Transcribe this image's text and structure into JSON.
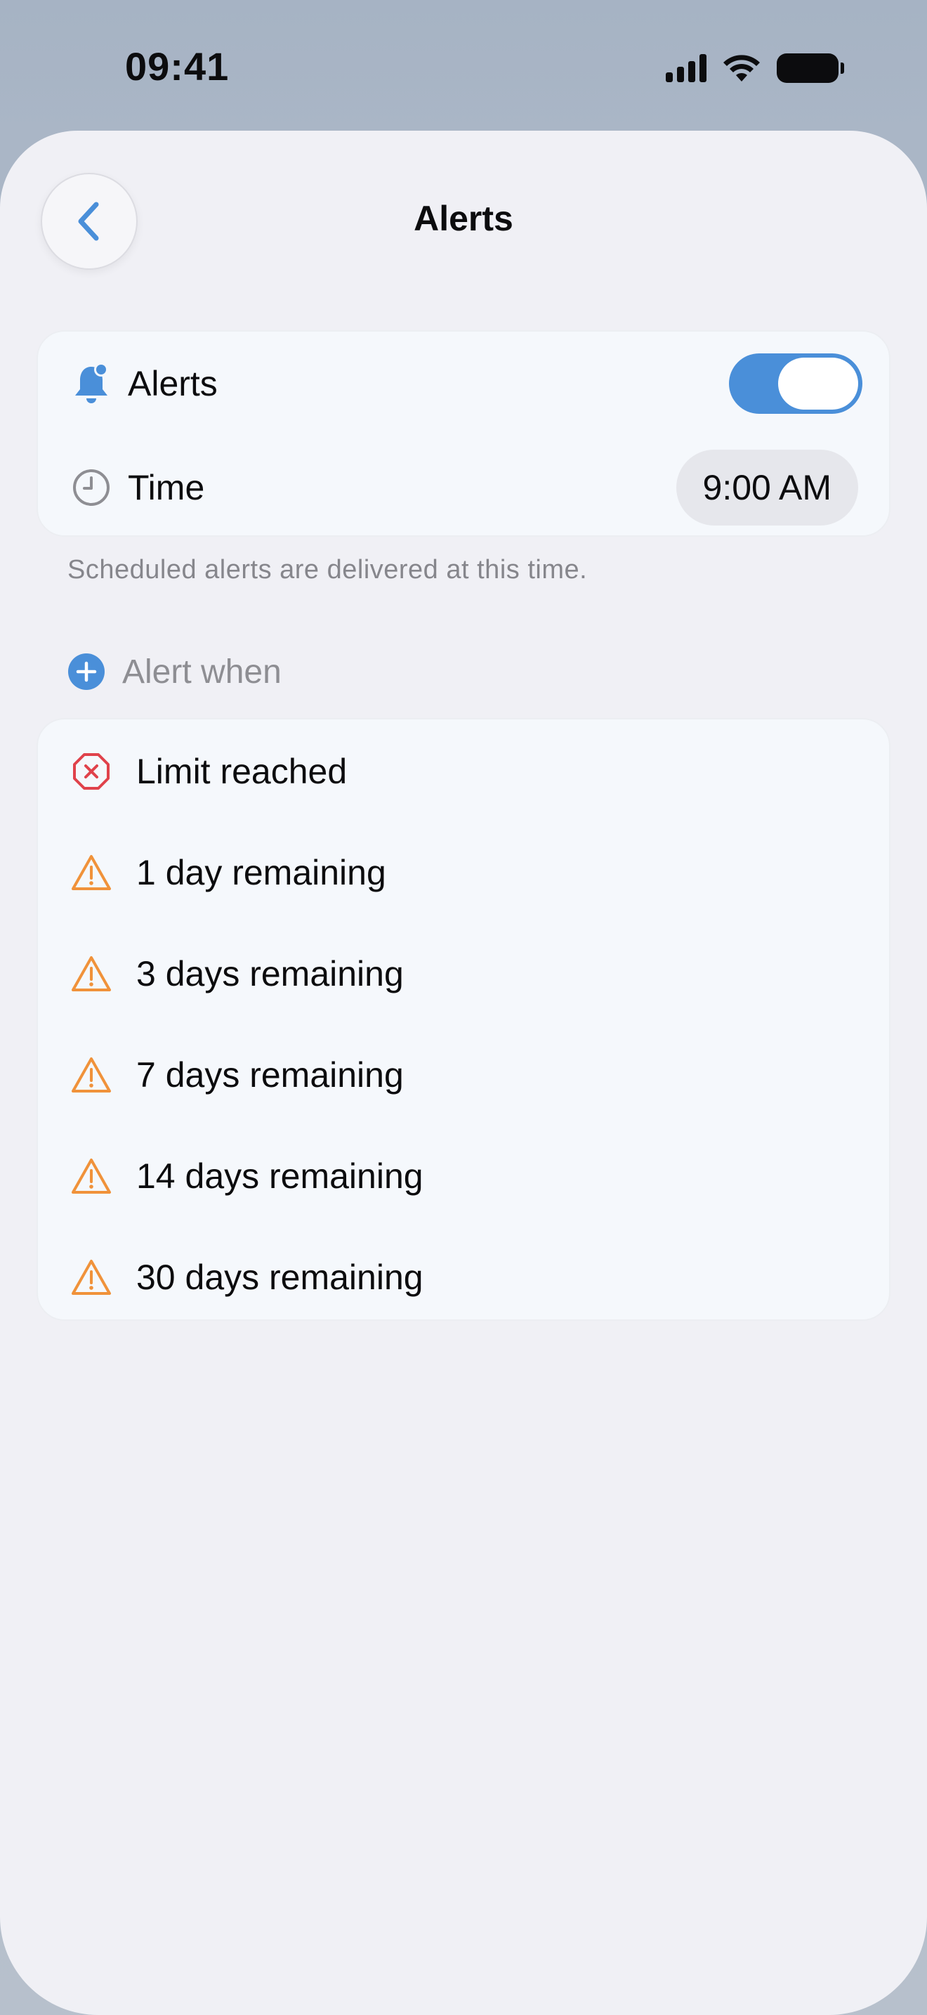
{
  "status_bar": {
    "time": "09:41"
  },
  "header": {
    "title": "Alerts"
  },
  "settings": {
    "alerts_label": "Alerts",
    "alerts_enabled": true,
    "time_label": "Time",
    "time_value": "9:00 AM",
    "footnote": "Scheduled alerts are delivered at this time."
  },
  "alert_when": {
    "header": "Alert when",
    "items": [
      {
        "label": "Limit reached",
        "icon": "x-octagon-icon"
      },
      {
        "label": "1 day remaining",
        "icon": "warning-triangle-icon"
      },
      {
        "label": "3 days remaining",
        "icon": "warning-triangle-icon"
      },
      {
        "label": "7 days remaining",
        "icon": "warning-triangle-icon"
      },
      {
        "label": "14 days remaining",
        "icon": "warning-triangle-icon"
      },
      {
        "label": "30 days remaining",
        "icon": "warning-triangle-icon"
      }
    ]
  },
  "colors": {
    "accent": "#4a8fd9",
    "error": "#e0424b",
    "warning": "#f0923a",
    "secondary_text": "#8e8e93"
  }
}
